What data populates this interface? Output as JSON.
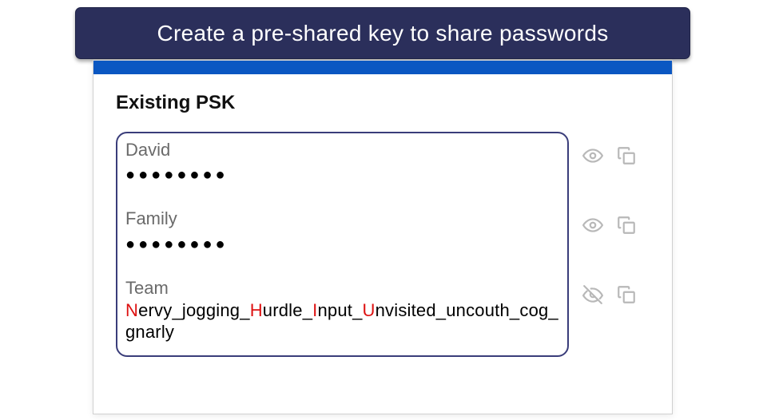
{
  "banner": {
    "title": "Create a pre-shared key to share passwords"
  },
  "section": {
    "heading": "Existing PSK"
  },
  "entries": [
    {
      "label": "David",
      "masked": "●●●●●●●●",
      "visible": false
    },
    {
      "label": "Family",
      "masked": "●●●●●●●●",
      "visible": false
    },
    {
      "label": "Team",
      "visible": true,
      "segments": [
        "N",
        "ervy_jogging_",
        "H",
        "urdle_",
        "I",
        "nput_",
        "U",
        "nvisited_uncouth_cog_gnarly"
      ],
      "plain": "Nervy_jogging_Hurdle_Input_Unvisited_uncouth_cog_gnarly"
    }
  ],
  "icons": {
    "eye": "eye-icon",
    "eyeOff": "eye-off-icon",
    "copy": "copy-icon"
  },
  "colors": {
    "accent": "#0a57c2",
    "border": "#3a3d7a",
    "highlight": "#d11"
  }
}
